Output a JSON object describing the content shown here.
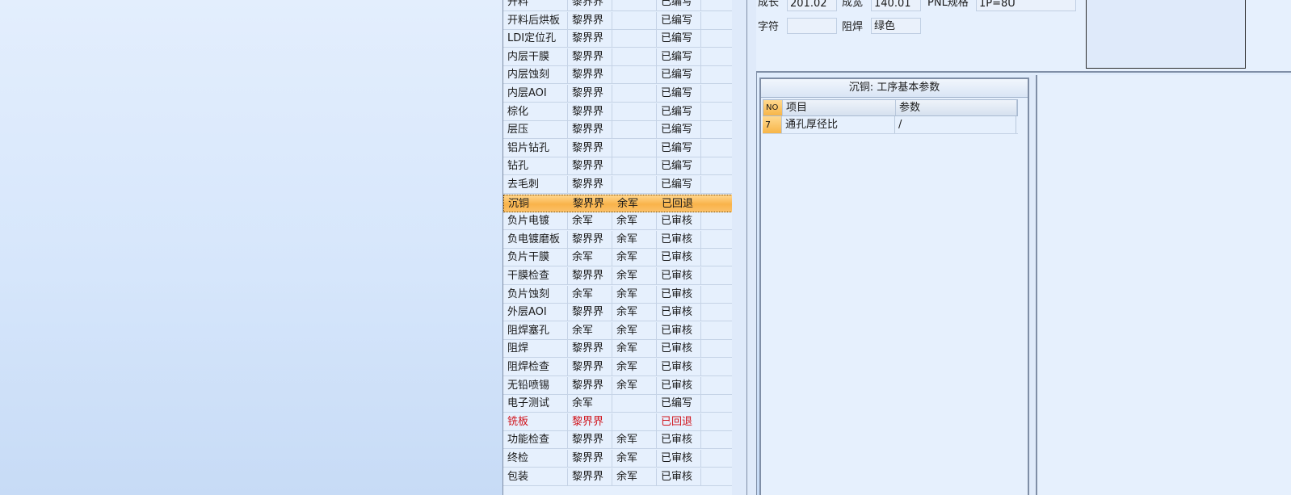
{
  "process_list": {
    "rows": [
      {
        "name": "开料",
        "c1": "黎界界",
        "c2": "",
        "status": "已编写"
      },
      {
        "name": "开料后烘板",
        "c1": "黎界界",
        "c2": "",
        "status": "已编写"
      },
      {
        "name": "LDI定位孔",
        "c1": "黎界界",
        "c2": "",
        "status": "已编写"
      },
      {
        "name": "内层干膜",
        "c1": "黎界界",
        "c2": "",
        "status": "已编写"
      },
      {
        "name": "内层蚀刻",
        "c1": "黎界界",
        "c2": "",
        "status": "已编写"
      },
      {
        "name": "内层AOI",
        "c1": "黎界界",
        "c2": "",
        "status": "已编写"
      },
      {
        "name": "棕化",
        "c1": "黎界界",
        "c2": "",
        "status": "已编写"
      },
      {
        "name": "层压",
        "c1": "黎界界",
        "c2": "",
        "status": "已编写"
      },
      {
        "name": "铝片钻孔",
        "c1": "黎界界",
        "c2": "",
        "status": "已编写"
      },
      {
        "name": "钻孔",
        "c1": "黎界界",
        "c2": "",
        "status": "已编写"
      },
      {
        "name": "去毛刺",
        "c1": "黎界界",
        "c2": "",
        "status": "已编写"
      },
      {
        "name": "沉铜",
        "c1": "黎界界",
        "c2": "余军",
        "status": "已回退",
        "selected": true
      },
      {
        "name": "负片电镀",
        "c1": "余军",
        "c2": "余军",
        "status": "已审核"
      },
      {
        "name": "负电镀磨板",
        "c1": "黎界界",
        "c2": "余军",
        "status": "已审核"
      },
      {
        "name": "负片干膜",
        "c1": "余军",
        "c2": "余军",
        "status": "已审核"
      },
      {
        "name": "干膜检查",
        "c1": "黎界界",
        "c2": "余军",
        "status": "已审核"
      },
      {
        "name": "负片蚀刻",
        "c1": "余军",
        "c2": "余军",
        "status": "已审核"
      },
      {
        "name": "外层AOI",
        "c1": "黎界界",
        "c2": "余军",
        "status": "已审核"
      },
      {
        "name": "阻焊塞孔",
        "c1": "余军",
        "c2": "余军",
        "status": "已审核"
      },
      {
        "name": "阻焊",
        "c1": "黎界界",
        "c2": "余军",
        "status": "已审核"
      },
      {
        "name": "阻焊检查",
        "c1": "黎界界",
        "c2": "余军",
        "status": "已审核"
      },
      {
        "name": "无铅喷锡",
        "c1": "黎界界",
        "c2": "余军",
        "status": "已审核"
      },
      {
        "name": "电子测试",
        "c1": "余军",
        "c2": "",
        "status": "已编写"
      },
      {
        "name": "铣板",
        "c1": "黎界界",
        "c2": "",
        "status": "已回退",
        "rejected": true
      },
      {
        "name": "功能检查",
        "c1": "黎界界",
        "c2": "余军",
        "status": "已审核"
      },
      {
        "name": "终检",
        "c1": "黎界界",
        "c2": "余军",
        "status": "已审核"
      },
      {
        "name": "包装",
        "c1": "黎界界",
        "c2": "余军",
        "status": "已审核"
      }
    ]
  },
  "form": {
    "length_label": "成长",
    "length_value": "201.02",
    "width_label": "成宽",
    "width_value": "140.01",
    "pnl_label": "PNL规格",
    "pnl_value": "1P=8U",
    "char_label": "字符",
    "char_value": "",
    "mask_label": "阻焊",
    "mask_value": "绿色"
  },
  "param_panel": {
    "title": "沉铜: 工序基本参数",
    "columns": [
      "NO",
      "项目",
      "参数"
    ],
    "rows": [
      {
        "no": "7",
        "item": "通孔厚径比",
        "value": "/"
      }
    ]
  },
  "colors": {
    "rejected_text": "#d0141c",
    "selected_row": "#f9b34a"
  }
}
